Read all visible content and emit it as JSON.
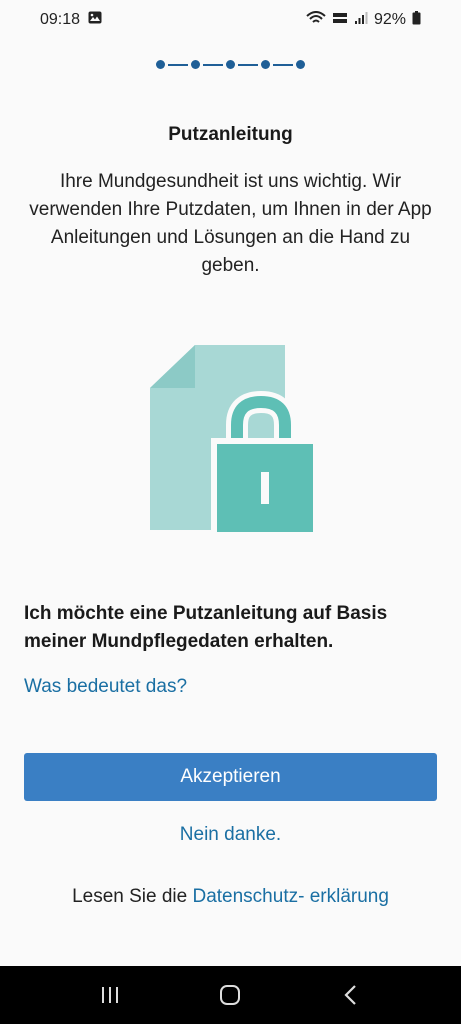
{
  "status_bar": {
    "time": "09:18",
    "battery": "92%"
  },
  "stepper": {
    "total_steps": 5,
    "current_step": 2
  },
  "screen": {
    "title": "Putzanleitung",
    "intro": "Ihre Mundgesundheit ist uns wichtig. Wir verwenden Ihre Putzdaten, um Ihnen in der App Anleitungen und Lösungen an die Hand zu geben.",
    "consent_text": "Ich möchte eine Putzanleitung auf Basis meiner Mundpflegedaten erhalten.",
    "what_link": "Was bedeutet das?",
    "accept_label": "Akzeptieren",
    "decline_label": "Nein danke.",
    "privacy_prefix": "Lesen Sie die ",
    "privacy_link": "Datenschutz- erklärung"
  },
  "icons": {
    "illustration": "document-lock-icon",
    "gallery": "image-icon",
    "wifi": "wifi-icon",
    "signal": "signal-icon",
    "battery": "battery-icon",
    "recents": "recents-icon",
    "home": "home-icon",
    "back": "back-icon"
  },
  "colors": {
    "accent": "#3a7fc4",
    "link": "#1a6fa3",
    "document": "#a8d8d5",
    "lock": "#5ebfb5"
  }
}
